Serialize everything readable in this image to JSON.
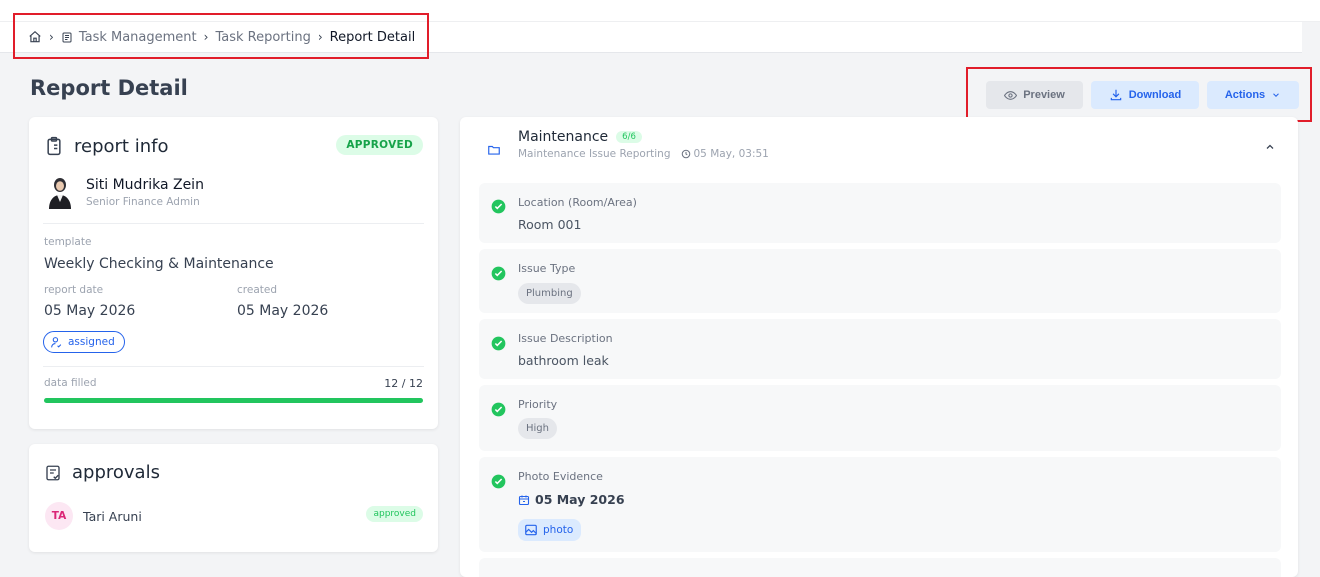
{
  "breadcrumb": {
    "home_icon": "home-icon",
    "item1": "Task Management",
    "item1_icon": "document-icon",
    "item2": "Task Reporting",
    "current": "Report Detail"
  },
  "page": {
    "title": "Report Detail"
  },
  "actions": {
    "preview": "Preview",
    "download": "Download",
    "actions": "Actions"
  },
  "report_info": {
    "title": "report info",
    "status": "APPROVED",
    "user_name": "Siti Mudrika Zein",
    "user_role": "Senior Finance Admin",
    "template_label": "template",
    "template_value": "Weekly Checking & Maintenance",
    "report_date_label": "report date",
    "report_date_value": "05 May 2026",
    "created_label": "created",
    "created_value": "05 May 2026",
    "assignment": "assigned",
    "data_filled_label": "data filled",
    "data_filled_value": "12 / 12",
    "data_filled_fraction": 1.0
  },
  "approvals": {
    "title": "approvals",
    "items": [
      {
        "initials": "TA",
        "name": "Tari Aruni",
        "status": "approved"
      }
    ]
  },
  "section": {
    "title": "Maintenance",
    "count": "6/6",
    "subtitle": "Maintenance Issue Reporting",
    "time": "05 May, 03:51"
  },
  "fields": [
    {
      "label": "Location (Room/Area)",
      "value": "Room 001"
    },
    {
      "label": "Issue Type",
      "value": "Plumbing"
    },
    {
      "label": "Issue Description",
      "value": "bathroom leak"
    },
    {
      "label": "Priority",
      "value": "High"
    },
    {
      "label": "Photo Evidence",
      "date": "05 May 2026",
      "attachment": "photo"
    }
  ],
  "colors": {
    "accent_blue": "#2563eb",
    "success_green": "#22c55e",
    "highlight_red": "#e11d2a"
  }
}
